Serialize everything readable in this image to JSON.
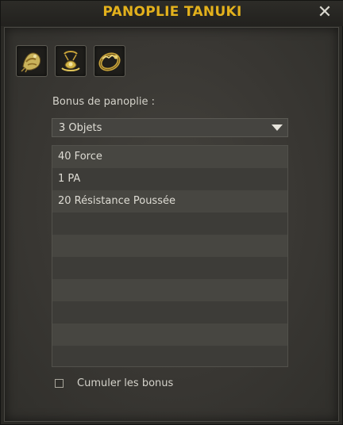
{
  "window": {
    "title": "PANOPLIE TANUKI",
    "close_glyph": "✕"
  },
  "items": [
    {
      "name": "tanuki-hat-icon",
      "color": "#c8a23a"
    },
    {
      "name": "tanuki-amulet-icon",
      "color": "#c8a23a"
    },
    {
      "name": "tanuki-ring-icon",
      "color": "#c8a23a"
    }
  ],
  "bonus": {
    "label": "Bonus de panoplie :",
    "selected": "3 Objets",
    "rows": [
      "40 Force",
      "1 PA",
      "20 Résistance Poussée",
      "",
      "",
      "",
      "",
      "",
      "",
      ""
    ]
  },
  "cumulate": {
    "label": "Cumuler les bonus",
    "checked": false
  },
  "colors": {
    "title": "#e3b11c",
    "row_light": "#474641",
    "row_dark": "#3d3c38"
  }
}
